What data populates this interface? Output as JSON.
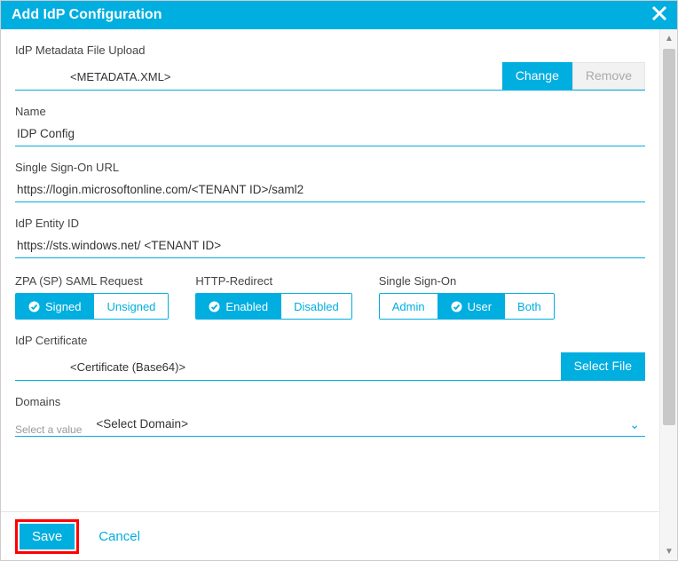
{
  "dialog": {
    "title": "Add IdP Configuration"
  },
  "metadata": {
    "label": "IdP Metadata File Upload",
    "value": "<METADATA.XML>",
    "change": "Change",
    "remove": "Remove"
  },
  "name": {
    "label": "Name",
    "value": "IDP Config"
  },
  "sso_url": {
    "label": "Single Sign-On URL",
    "prefix": "https://login.microsoftonline.com/",
    "mid": "<TENANT ID>",
    "suffix": "/saml2"
  },
  "entity": {
    "label": "IdP Entity ID",
    "prefix": "https://sts.windows.net/ ",
    "mid": "<TENANT ID>"
  },
  "toggles": {
    "saml": {
      "label": "ZPA (SP) SAML Request",
      "opt1": "Signed",
      "opt2": "Unsigned"
    },
    "http": {
      "label": "HTTP-Redirect",
      "opt1": "Enabled",
      "opt2": "Disabled"
    },
    "sso": {
      "label": "Single Sign-On",
      "opt1": "Admin",
      "opt2": "User",
      "opt3": "Both"
    }
  },
  "cert": {
    "label": "IdP Certificate",
    "value": "<Certificate (Base64)>",
    "select": "Select File"
  },
  "domains": {
    "label": "Domains",
    "placeholder": "Select a value",
    "value": "<Select Domain>"
  },
  "footer": {
    "save": "Save",
    "cancel": "Cancel"
  }
}
